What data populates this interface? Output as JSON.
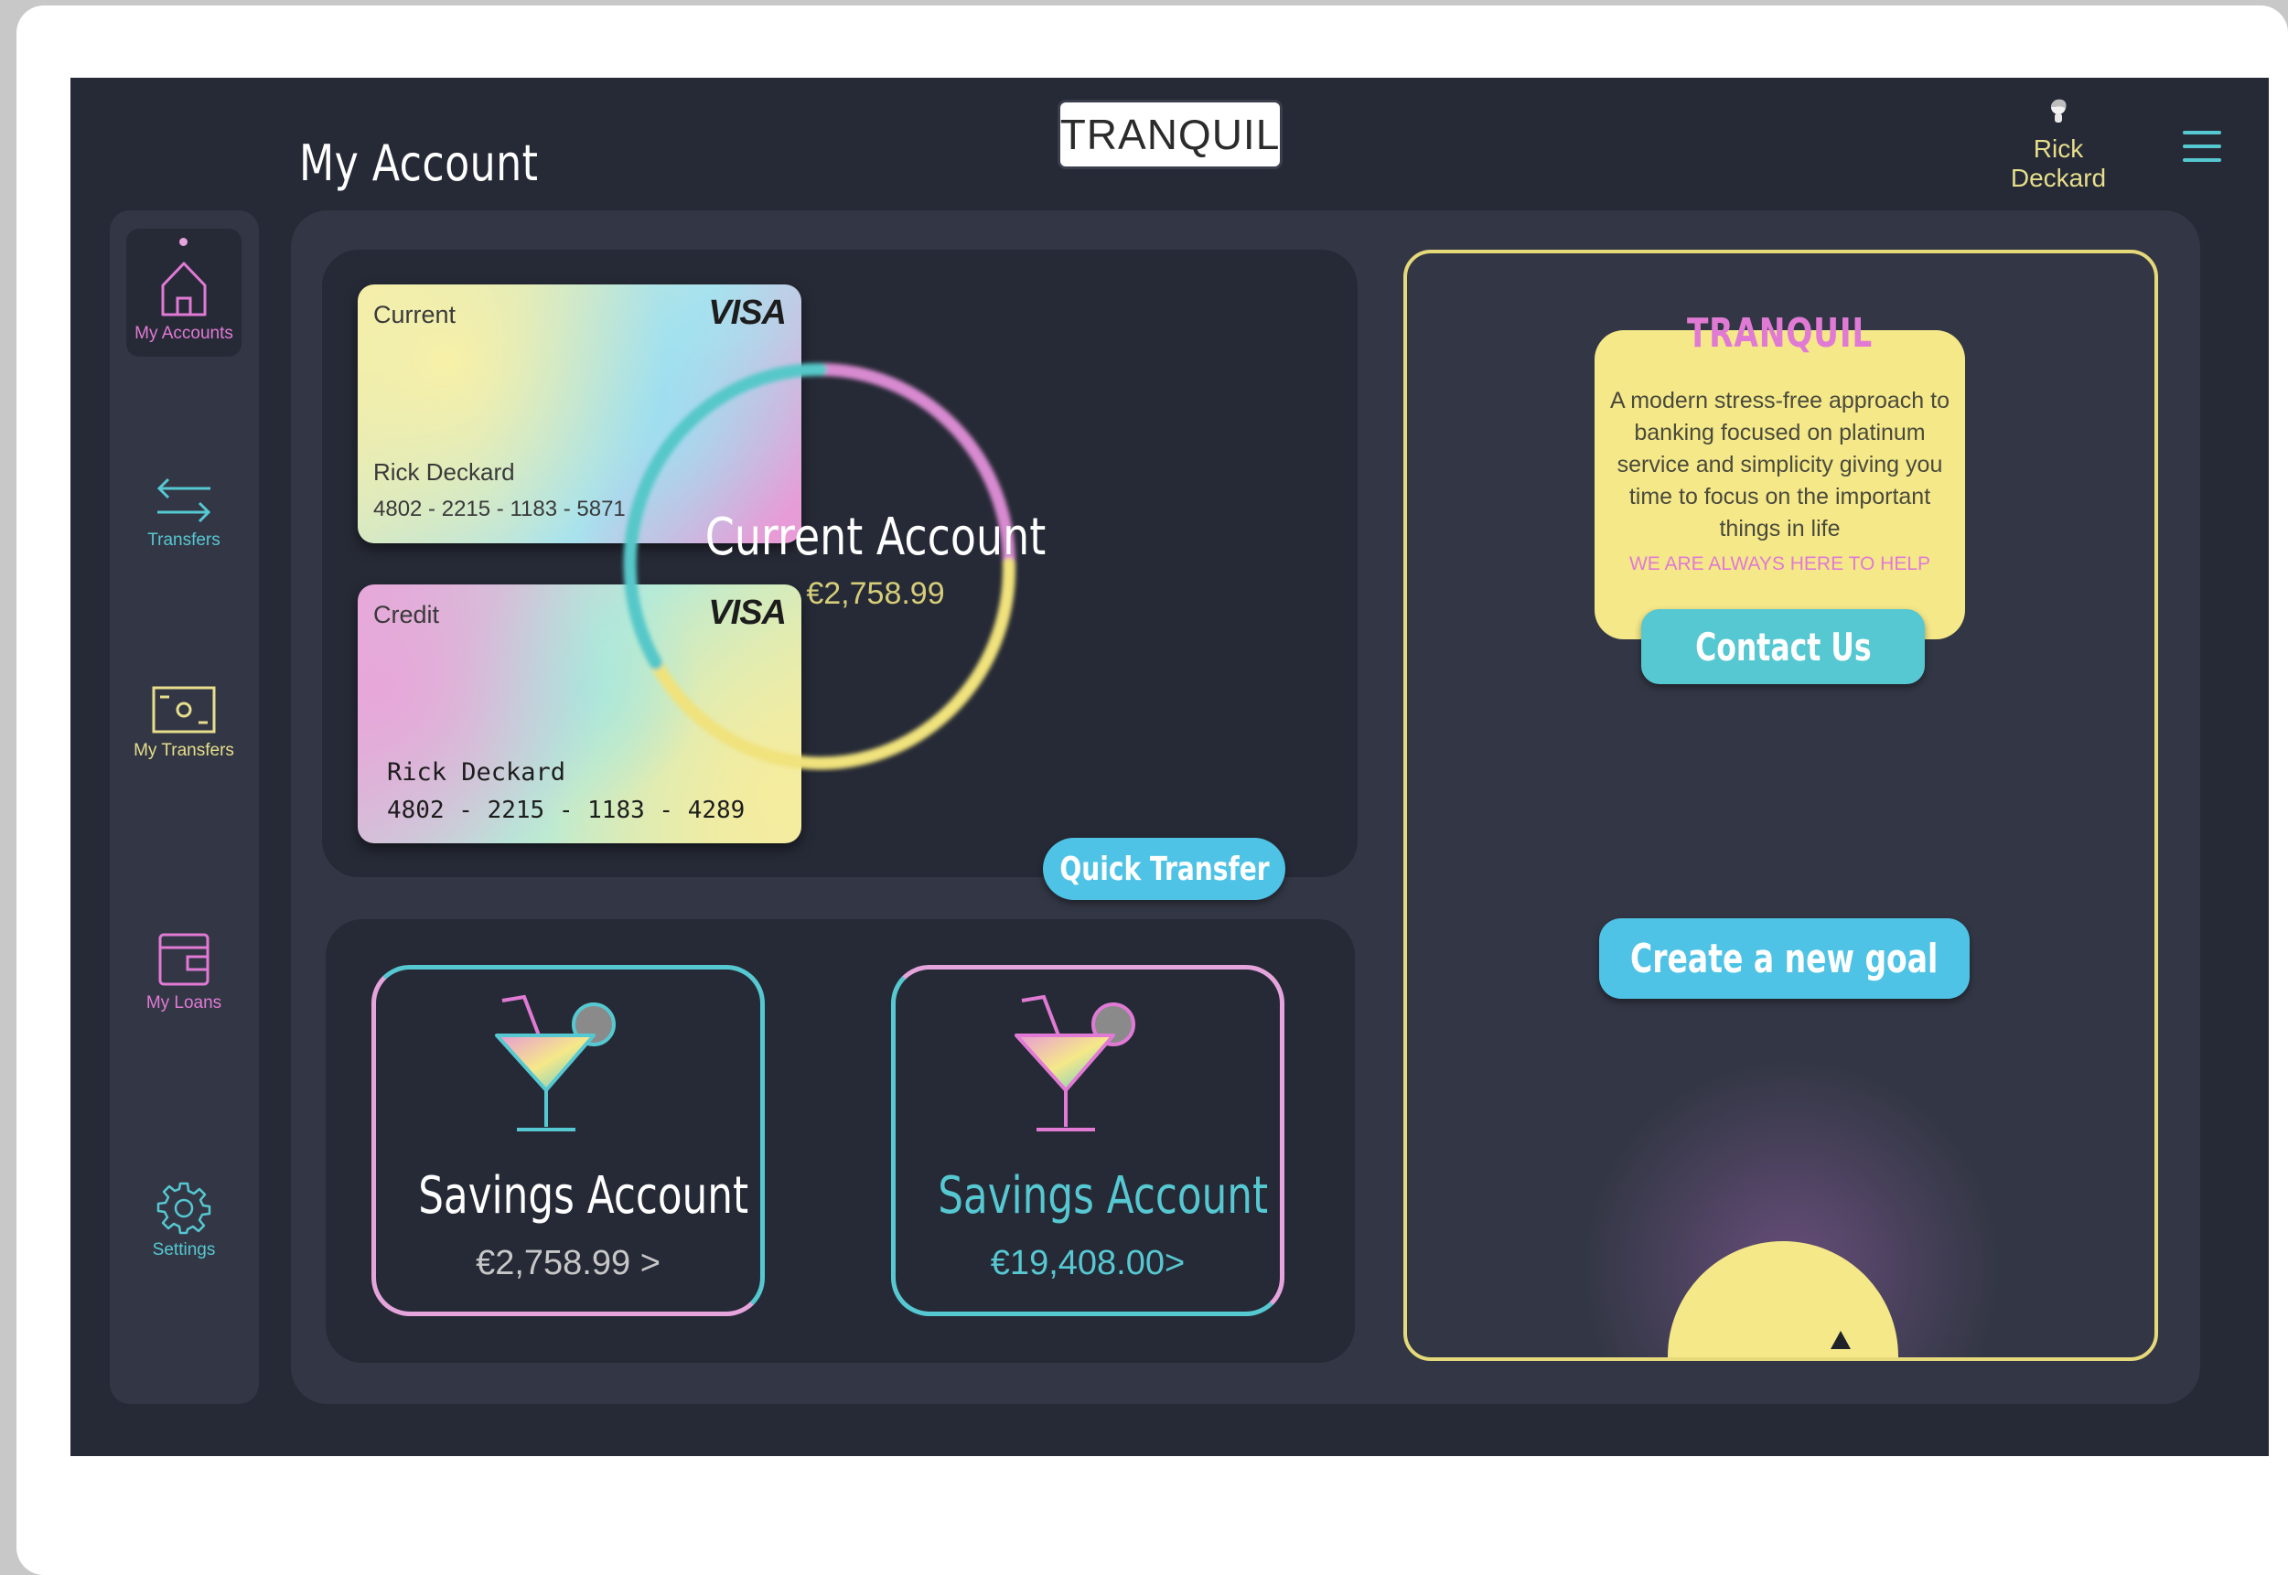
{
  "header": {
    "page_title": "My Account",
    "logo": "TRANQUIL",
    "user_name": "Rick Deckard"
  },
  "sidebar": {
    "items": [
      {
        "label": "My Accounts",
        "icon": "home-icon",
        "active": true
      },
      {
        "label": "Transfers",
        "icon": "transfer-arrows-icon"
      },
      {
        "label": "My Transfers",
        "icon": "cash-icon"
      },
      {
        "label": "My Loans",
        "icon": "wallet-icon"
      },
      {
        "label": "Settings",
        "icon": "gear-icon"
      }
    ]
  },
  "cards": [
    {
      "type": "Current",
      "brand": "VISA",
      "holder": "Rick Deckard",
      "number": "4802 - 2215 - 1183 - 5871"
    },
    {
      "type": "Credit",
      "brand": "VISA",
      "holder": "Rick Deckard",
      "number": "4802 - 2215 - 1183 - 4289"
    }
  ],
  "current_account": {
    "title": "Current Account",
    "balance": "€2,758.99"
  },
  "quick_transfer_label": "Quick Transfer",
  "savings": [
    {
      "title": "Savings Account",
      "balance": "€2,758.99",
      "chevron": ">"
    },
    {
      "title": "Savings Account",
      "balance": "€19,408.00",
      "chevron": ">"
    }
  ],
  "goals_panel": {
    "brand": "TRANQUIL",
    "description": "A modern stress-free approach to banking focused on platinum service and simplicity giving you time to focus on the important things in life",
    "help_text": "WE ARE ALWAYS HERE TO HELP",
    "contact_label": "Contact Us",
    "create_goal_label": "Create a new goal"
  },
  "colors": {
    "background": "#262a36",
    "panel": "#333745",
    "teal": "#56c8d1",
    "pink": "#e07ad5",
    "yellow": "#f5e889",
    "button_blue": "#4ec3e6"
  }
}
